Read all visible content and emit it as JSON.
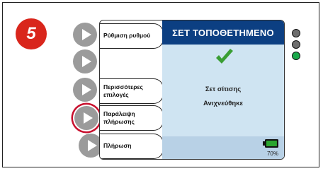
{
  "step_number": "5",
  "screen": {
    "title": "ΣΕΤ ΤΟΠΟΘΕΤΗΜΕΝΟ",
    "message_line1": "Σετ σίτισης",
    "message_line2": "Ανιχνεύθηκε",
    "battery_percent": "70%",
    "battery_level": 0.7
  },
  "soft_keys": [
    {
      "label": "Ρύθμιση ρυθμού"
    },
    {
      "label": "Περισσότερες επιλογές"
    },
    {
      "label": "Παράλειψη πλήρωσης"
    },
    {
      "label": "Πλήρωση"
    }
  ],
  "indicators": [
    {
      "name": "led-1",
      "color": "#6e6e6e"
    },
    {
      "name": "led-2",
      "color": "#6e6e6e"
    },
    {
      "name": "led-3",
      "color": "#1aa84a"
    }
  ],
  "colors": {
    "badge": "#d9261c",
    "header": "#0c3f82",
    "screen_bg": "#cfe4f2",
    "checkmark": "#3a9e34",
    "highlight_ring": "#c8102e",
    "battery": "#2aa52f"
  },
  "highlighted_button_index": 3
}
